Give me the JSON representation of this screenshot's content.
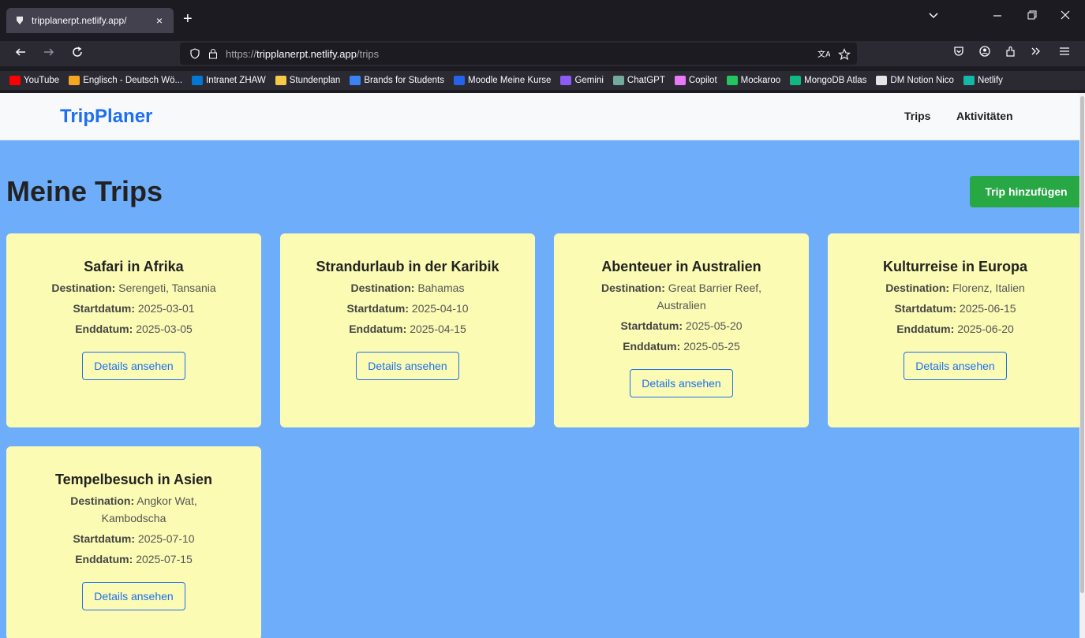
{
  "browser": {
    "tab_title": "tripplanerpt.netlify.app/",
    "tab_close": "×",
    "new_tab": "+",
    "url_prefix": "https://",
    "url_host": "tripplanerpt.netlify.app",
    "url_path": "/trips"
  },
  "bookmarks": [
    {
      "label": "YouTube",
      "color": "#ff0000"
    },
    {
      "label": "Englisch - Deutsch Wö...",
      "color": "#f5a623"
    },
    {
      "label": "Intranet ZHAW",
      "color": "#0078d4"
    },
    {
      "label": "Stundenplan",
      "color": "#f7c948"
    },
    {
      "label": "Brands for Students",
      "color": "#3b82f6"
    },
    {
      "label": "Moodle Meine Kurse",
      "color": "#2563eb"
    },
    {
      "label": "Gemini",
      "color": "#8b5cf6"
    },
    {
      "label": "ChatGPT",
      "color": "#74aa9c"
    },
    {
      "label": "Copilot",
      "color": "#e879f9"
    },
    {
      "label": "Mockaroo",
      "color": "#22c55e"
    },
    {
      "label": "MongoDB Atlas",
      "color": "#10b981"
    },
    {
      "label": "DM Notion Nico",
      "color": "#e5e5e5"
    },
    {
      "label": "Netlify",
      "color": "#14b8a6"
    }
  ],
  "site": {
    "brand": "TripPlaner",
    "nav": [
      "Trips",
      "Aktivitäten"
    ],
    "page_title": "Meine Trips",
    "add_button": "Trip hinzufügen",
    "labels": {
      "destination": "Destination:",
      "start": "Startdatum:",
      "end": "Enddatum:",
      "details": "Details ansehen"
    }
  },
  "trips": [
    {
      "title": "Safari in Afrika",
      "destination": "Serengeti, Tansania",
      "start": "2025-03-01",
      "end": "2025-03-05"
    },
    {
      "title": "Strandurlaub in der Karibik",
      "destination": "Bahamas",
      "start": "2025-04-10",
      "end": "2025-04-15"
    },
    {
      "title": "Abenteuer in Australien",
      "destination": "Great Barrier Reef, Australien",
      "start": "2025-05-20",
      "end": "2025-05-25"
    },
    {
      "title": "Kulturreise in Europa",
      "destination": "Florenz, Italien",
      "start": "2025-06-15",
      "end": "2025-06-20"
    },
    {
      "title": "Tempelbesuch in Asien",
      "destination": "Angkor Wat, Kambodscha",
      "start": "2025-07-10",
      "end": "2025-07-15"
    }
  ],
  "colors": {
    "page_bg": "#6eadfa",
    "card_bg": "#fbfbb4",
    "brand": "#1e6ff0",
    "add_button": "#28a745"
  }
}
